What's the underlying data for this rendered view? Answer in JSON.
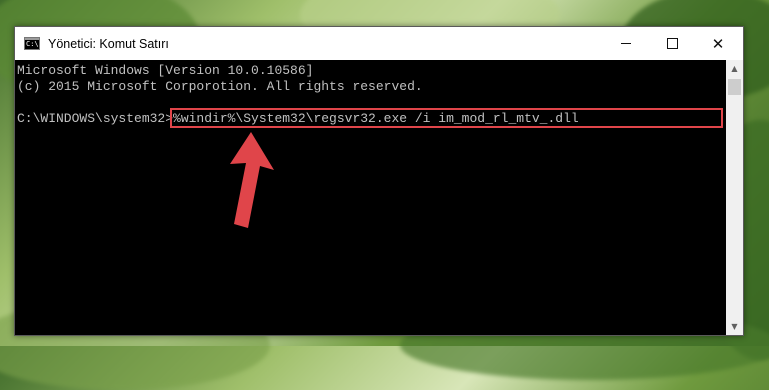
{
  "window": {
    "title": "Yönetici: Komut Satırı",
    "icon_text": "C:\\"
  },
  "console": {
    "lines": [
      "Microsoft Windows [Version 10.0.10586]",
      "(c) 2015 Microsoft Corporotion. All rights reserved.",
      "",
      "C:\\WINDOWS\\system32>%windir%\\System32\\regsvr32.exe /i im_mod_rl_mtv_.dll"
    ]
  },
  "colors": {
    "highlight_border": "#e0454a",
    "arrow": "#e0454a",
    "console_text": "#c0c0c0",
    "console_bg": "#000000"
  }
}
